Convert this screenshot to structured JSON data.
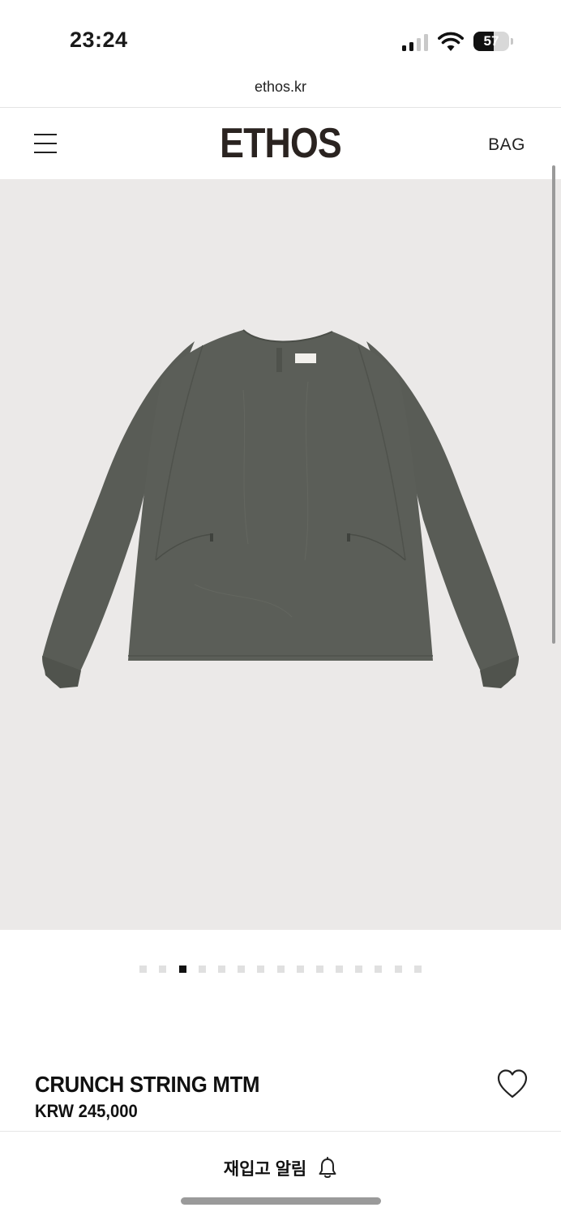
{
  "status_bar": {
    "time": "23:24",
    "battery_level": "57",
    "battery_fraction": 0.57,
    "signal_bars_filled": 2,
    "signal_bars_total": 4,
    "icons": [
      "cellular-signal-icon",
      "wifi-icon",
      "battery-icon"
    ]
  },
  "browser": {
    "url": "ethos.kr"
  },
  "header": {
    "menu_icon": "hamburger-menu-icon",
    "logo": "ETHOS",
    "bag_label": "BAG"
  },
  "product": {
    "image_alt": "",
    "image_background": "#ebe9e8",
    "garment_color": "#5b5e58",
    "gallery_total": 15,
    "gallery_active_index": 2,
    "name": "CRUNCH STRING MTM",
    "price": "KRW 245,000",
    "wishlist_icon": "heart-outline-icon"
  },
  "bottom_bar": {
    "restock_label": "재입고 알림",
    "restock_icon": "bell-icon"
  },
  "colors": {
    "text": "#111111",
    "divider": "#e3e3e3",
    "dot_inactive": "#e0e0e0",
    "dot_active": "#111111"
  }
}
